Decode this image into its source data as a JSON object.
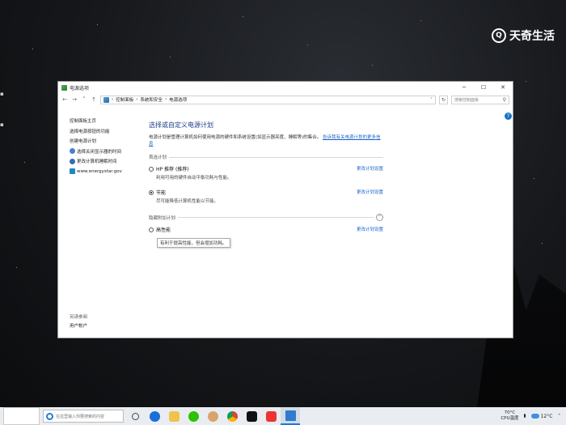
{
  "watermark": {
    "logo": "Q",
    "text": "天奇生活"
  },
  "window": {
    "title": "电源选项",
    "controls": {
      "minimize": "─",
      "maximize": "☐",
      "close": "✕"
    },
    "address": {
      "crumbs": [
        "控制面板",
        "系统和安全",
        "电源选项"
      ],
      "search_placeholder": "搜索控制面板"
    },
    "left_pane": {
      "items": [
        {
          "label": "控制面板主页"
        },
        {
          "label": "选择电源按钮的功能"
        },
        {
          "label": "创建电源计划"
        },
        {
          "label": "选择关闭显示器的时间"
        },
        {
          "label": "更改计算机睡眠时间"
        },
        {
          "label": "www.energystar.gov"
        }
      ],
      "see_also_label": "另请参阅",
      "see_also_items": [
        "用户帐户"
      ]
    },
    "main": {
      "title": "选择或自定义电源计划",
      "description": "电源计划是管理计算机如何使用电源的硬件和系统设置(如显示器亮度、睡眠等)的集合。",
      "more_link": "告诉我有关电源计划的更多信息",
      "preferred_group": {
        "label": "首选计划",
        "plans": [
          {
            "name": "HP 推荐 (推荐)",
            "desc": "利用可用的硬件自动平衡功耗与性能。",
            "change": "更改计划设置",
            "selected": false
          },
          {
            "name": "节能",
            "desc": "尽可能降低计算机性能以节能。",
            "change": "更改计划设置",
            "selected": true
          }
        ]
      },
      "hidden_group": {
        "label": "隐藏附加计划",
        "plans": [
          {
            "name": "高性能",
            "desc": "",
            "change": "更改计划设置",
            "selected": false
          }
        ],
        "tooltip": "有利于提高性能，但会增加功耗。"
      }
    }
  },
  "taskbar": {
    "search_placeholder": "在这里输入你要搜索的内容",
    "clock": {
      "temp_line": "70°C",
      "label_line": "CPU温度"
    },
    "weather": "12°C"
  }
}
